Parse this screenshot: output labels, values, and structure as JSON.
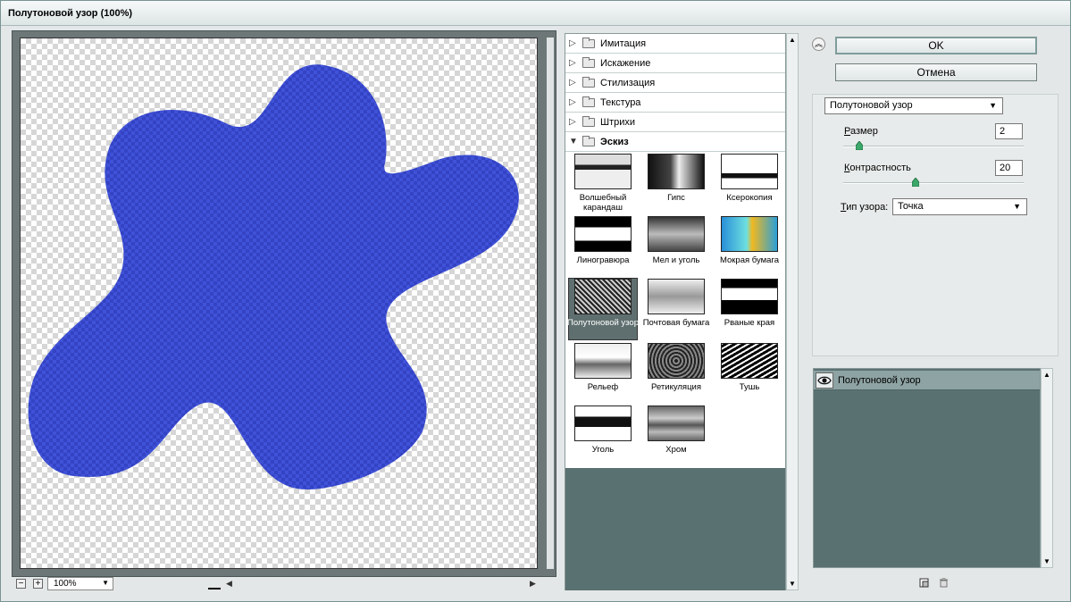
{
  "window": {
    "title": "Полутоновой узор (100%)"
  },
  "preview": {
    "zoom": "100%",
    "zoom_out": "−",
    "zoom_in": "+"
  },
  "gallery": {
    "categories": [
      {
        "label": "Имитация",
        "open": false
      },
      {
        "label": "Искажение",
        "open": false
      },
      {
        "label": "Стилизация",
        "open": false
      },
      {
        "label": "Текстура",
        "open": false
      },
      {
        "label": "Штрихи",
        "open": false
      },
      {
        "label": "Эскиз",
        "open": true
      }
    ],
    "thumbs": [
      {
        "label": "Волшебный карандаш"
      },
      {
        "label": "Гипс"
      },
      {
        "label": "Ксерокопия"
      },
      {
        "label": "Линогравюра"
      },
      {
        "label": "Мел и уголь"
      },
      {
        "label": "Мокрая бумага"
      },
      {
        "label": "Полутоновой узор",
        "selected": true
      },
      {
        "label": "Почтовая бумага"
      },
      {
        "label": "Рваные края"
      },
      {
        "label": "Рельеф"
      },
      {
        "label": "Ретикуляция"
      },
      {
        "label": "Тушь"
      },
      {
        "label": "Уголь"
      },
      {
        "label": "Хром"
      }
    ]
  },
  "buttons": {
    "ok": "OK",
    "cancel": "Отмена"
  },
  "settings": {
    "filter_select": "Полутоновой узор",
    "size_label_u": "Р",
    "size_label_rest": "азмер",
    "size_value": "2",
    "size_fraction": 0.09,
    "contrast_label_u": "К",
    "contrast_label_rest": "онтрастность",
    "contrast_value": "20",
    "contrast_fraction": 0.4,
    "pattern_label_u": "Т",
    "pattern_label_rest": "ип узора:",
    "pattern_value": "Точка"
  },
  "layers": {
    "items": [
      {
        "label": "Полутоновой узор"
      }
    ]
  },
  "colors": {
    "shape": "#3949d0",
    "panel_dark": "#5a7171",
    "selected_thumb": "#5f6f6f"
  },
  "icons": {
    "eye": "eye-icon",
    "new_layer": "new-layer-icon",
    "delete_layer": "trash-icon",
    "collapse": "double-chevron-up-icon"
  }
}
